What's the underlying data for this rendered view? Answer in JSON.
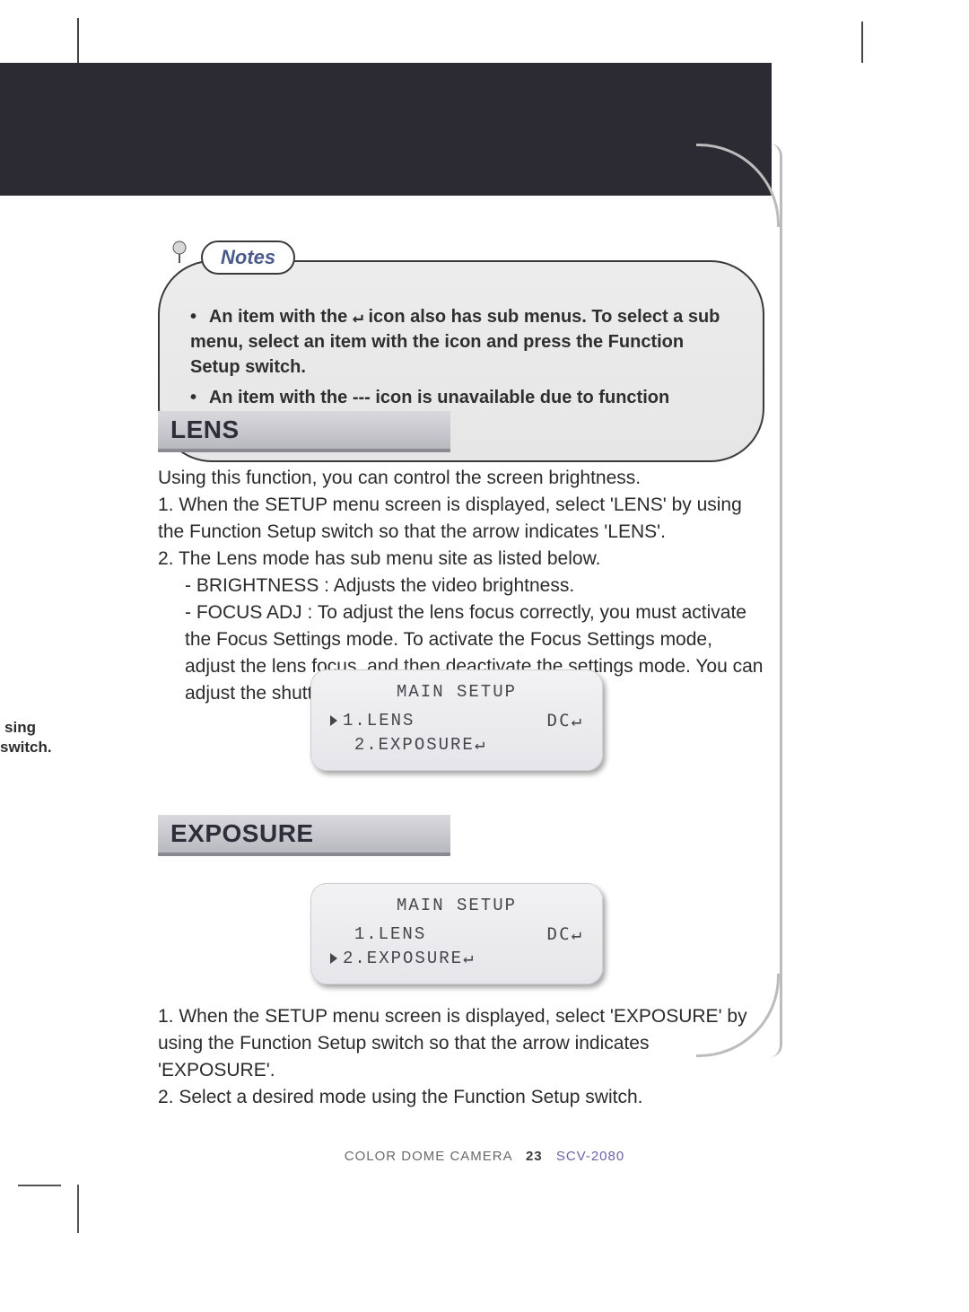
{
  "notes": {
    "label": "Notes",
    "items": [
      {
        "pre": "An item with the ",
        "sym": "↵",
        "post": " icon also has sub menus. To select a sub menu, select an item with the icon and press the Function Setup switch."
      },
      {
        "pre": "An item with the --- icon is unavailable due to function settings.",
        "sym": "",
        "post": ""
      }
    ]
  },
  "sections": {
    "lens": {
      "title": "LENS",
      "intro": "Using this function, you can control the screen brightness.",
      "steps": [
        "1. When the SETUP menu screen is displayed, select 'LENS' by using the Function Setup switch so that the arrow indicates 'LENS'.",
        "2. The Lens mode has sub menu site as listed below."
      ],
      "subitems": [
        "- BRIGHTNESS : Adjusts the video brightness.",
        "- FOCUS ADJ   : To adjust the lens focus correctly, you must activate the Focus Settings mode. To activate the Focus Settings mode, adjust the lens focus, and then deactivate the settings mode. You can adjust the shutter value of ESC shutter mode."
      ]
    },
    "exposure": {
      "title": "EXPOSURE",
      "steps": [
        "1. When the SETUP menu screen is displayed, select 'EXPOSURE' by using the Function Setup switch so that the arrow indicates 'EXPOSURE'.",
        "2. Select a desired mode using the Function Setup switch."
      ]
    }
  },
  "osd1": {
    "title": "MAIN SETUP",
    "rows": [
      {
        "cursor": true,
        "left": "1.LENS",
        "right": "DC↵"
      },
      {
        "cursor": false,
        "left": "2.EXPOSURE↵",
        "right": ""
      }
    ]
  },
  "osd2": {
    "title": "MAIN SETUP",
    "rows": [
      {
        "cursor": false,
        "left": "1.LENS",
        "right": "DC↵"
      },
      {
        "cursor": true,
        "left": "2.EXPOSURE↵",
        "right": ""
      }
    ]
  },
  "leftfrag": {
    "line1": "sing",
    "line2": "switch."
  },
  "footer": {
    "left": "COLOR DOME CAMERA",
    "page": "23",
    "model": "SCV-2080"
  }
}
